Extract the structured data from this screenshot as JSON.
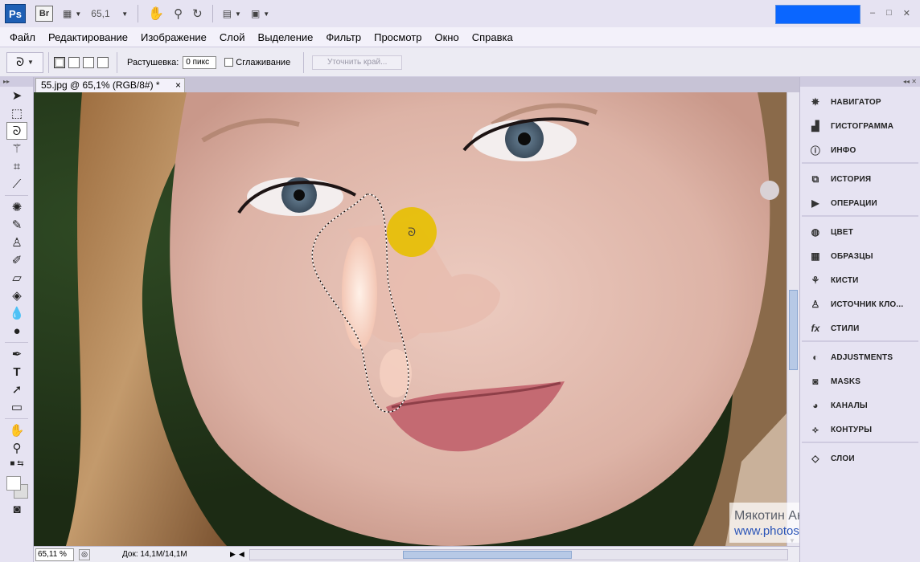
{
  "appbar": {
    "ps_logo": "Ps",
    "br_logo": "Br",
    "zoom_value": "65,1",
    "window_buttons": [
      "–",
      "□",
      "✕"
    ]
  },
  "menu": [
    "Файл",
    "Редактирование",
    "Изображение",
    "Слой",
    "Выделение",
    "Фильтр",
    "Просмотр",
    "Окно",
    "Справка"
  ],
  "options": {
    "feather_label": "Растушевка:",
    "feather_value": "0 пикс",
    "antialias_label": "Сглаживание",
    "refine_edge_label": "Уточнить край..."
  },
  "document": {
    "tab_title": "55.jpg @ 65,1% (RGB/8#) *",
    "close_glyph": "×"
  },
  "status": {
    "zoom": "65,11 %",
    "doc_info": "Док: 14,1M/14,1M"
  },
  "panels": {
    "group1": [
      "НАВИГАТОР",
      "ГИСТОГРАММА",
      "ИНФО"
    ],
    "group2": [
      "ИСТОРИЯ",
      "ОПЕРАЦИИ"
    ],
    "group3": [
      "ЦВЕТ",
      "ОБРАЗЦЫ",
      "КИСТИ",
      "ИСТОЧНИК КЛО...",
      "СТИЛИ"
    ],
    "group4": [
      "ADJUSTMENTS",
      "MASKS",
      "КАНАЛЫ",
      "КОНТУРЫ"
    ],
    "group5": [
      "СЛОИ"
    ]
  },
  "watermark": {
    "name": "Мякотин Антон.",
    "url": "www.photoshop-video.com"
  },
  "colors": {
    "accent_blue": "#0a66ff",
    "cursor_highlight": "#e8c000"
  }
}
